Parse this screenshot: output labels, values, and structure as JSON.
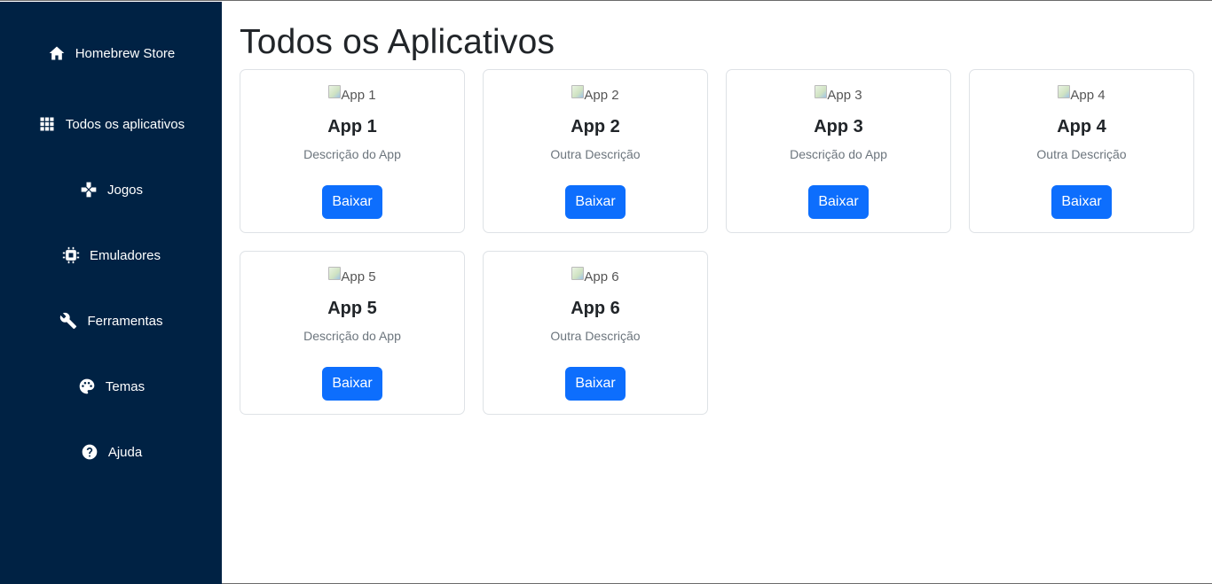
{
  "sidebar": {
    "items": [
      {
        "label": "Homebrew Store",
        "icon": "home-icon"
      },
      {
        "label": "Todos os aplicativos",
        "icon": "grid-icon"
      },
      {
        "label": "Jogos",
        "icon": "gamepad-icon"
      },
      {
        "label": "Emuladores",
        "icon": "chip-icon"
      },
      {
        "label": "Ferramentas",
        "icon": "wrench-icon"
      },
      {
        "label": "Temas",
        "icon": "palette-icon"
      },
      {
        "label": "Ajuda",
        "icon": "help-icon"
      }
    ]
  },
  "main": {
    "title": "Todos os Aplicativos",
    "apps": [
      {
        "alt": "App 1",
        "name": "App 1",
        "description": "Descrição do App",
        "button": "Baixar"
      },
      {
        "alt": "App 2",
        "name": "App 2",
        "description": "Outra Descrição",
        "button": "Baixar"
      },
      {
        "alt": "App 3",
        "name": "App 3",
        "description": "Descrição do App",
        "button": "Baixar"
      },
      {
        "alt": "App 4",
        "name": "App 4",
        "description": "Outra Descrição",
        "button": "Baixar"
      },
      {
        "alt": "App 5",
        "name": "App 5",
        "description": "Descrição do App",
        "button": "Baixar"
      },
      {
        "alt": "App 6",
        "name": "App 6",
        "description": "Outra Descrição",
        "button": "Baixar"
      }
    ]
  },
  "colors": {
    "sidebar_bg": "#002244",
    "button_bg": "#0d6efd",
    "text_dark": "#212529",
    "text_muted": "#6c757d"
  }
}
